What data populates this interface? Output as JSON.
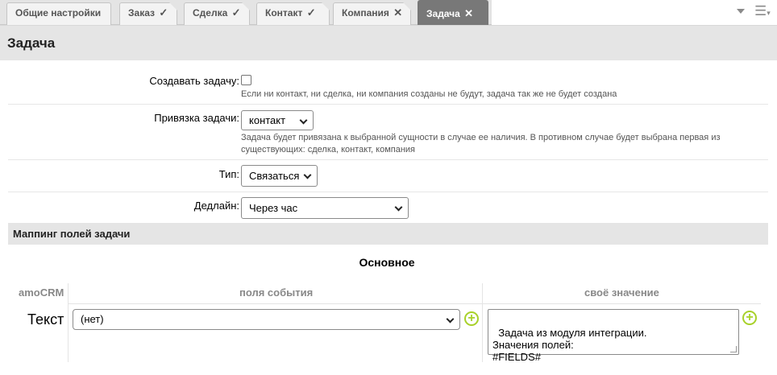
{
  "tabs": [
    {
      "label": "Общие настройки",
      "mark": ""
    },
    {
      "label": "Заказ",
      "mark": "✓"
    },
    {
      "label": "Сделка",
      "mark": "✓"
    },
    {
      "label": "Контакт",
      "mark": "✓"
    },
    {
      "label": "Компания",
      "mark": "✕"
    },
    {
      "label": "Задача",
      "mark": "✕",
      "active": true
    }
  ],
  "section": {
    "title": "Задача"
  },
  "form": {
    "create_task": {
      "label": "Создавать задачу:",
      "checked": false,
      "hint": "Если ни контакт, ни сделка, ни компания созданы не будут, задача так же не будет создана"
    },
    "task_binding": {
      "label": "Привязка задачи:",
      "value": "контакт",
      "hint_line1": "Задача будет привязана к выбранной сущности в случае ее наличия. В противном случае будет выбрана первая из",
      "hint_line2": "существующих: сделка, контакт, компания"
    },
    "type": {
      "label": "Тип:",
      "value": "Связаться"
    },
    "deadline": {
      "label": "Дедлайн:",
      "value": "Через час"
    }
  },
  "mapping": {
    "title": "Маппинг полей задачи",
    "group_title": "Основное",
    "columns": {
      "amocrm": "amoCRM",
      "event_fields": "поля события",
      "own_value": "своё значение"
    },
    "rows": [
      {
        "field": "Текст",
        "event_value": "(нет)",
        "own_value": "Задача из модуля интеграции.\nЗначения полей:\n#FIELDS#"
      }
    ]
  },
  "colors": {
    "tab_active_bg": "#787878",
    "section_bg": "#e5e5e5",
    "plus_accent": "#a8d12a"
  },
  "icons": {
    "tab_dropdown": "triangle-down",
    "tab_menu": "hamburger-with-caret",
    "add": "plus-circle"
  }
}
